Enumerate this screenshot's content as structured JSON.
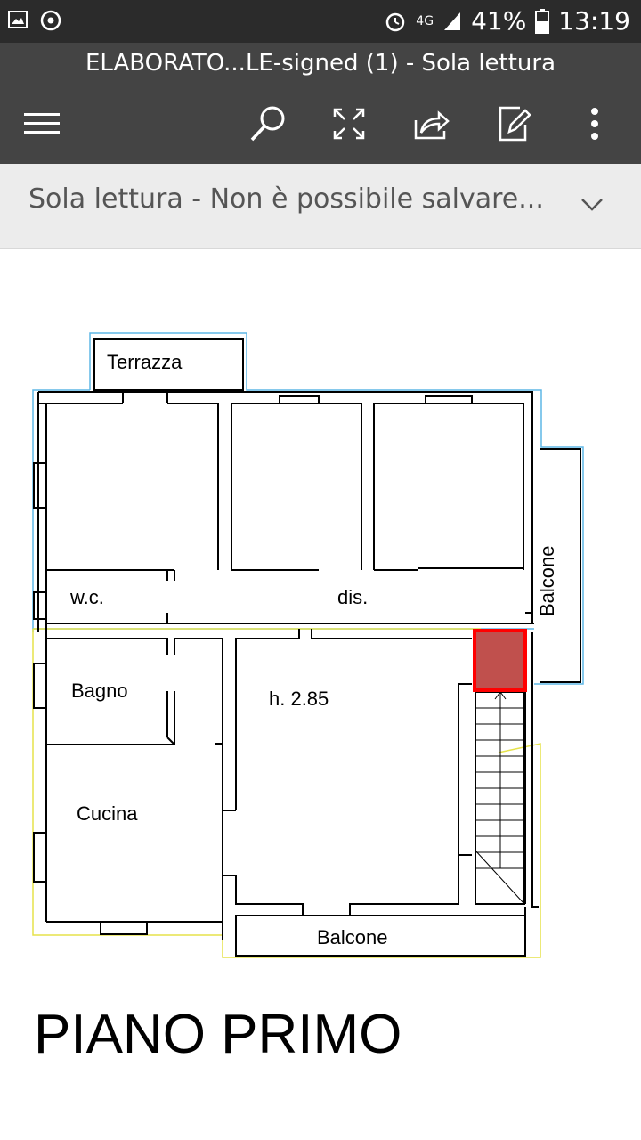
{
  "status_bar": {
    "battery": "41%",
    "time": "13:19",
    "network": "4G"
  },
  "toolbar": {
    "document_title": "ELABORATO...LE-signed (1) - Sola lettura",
    "icons": [
      "menu-icon",
      "search-icon",
      "fullscreen-icon",
      "share-icon",
      "edit-icon",
      "more-icon"
    ]
  },
  "info_bar": {
    "message": "Sola lettura - Non è possibile salvare..."
  },
  "floor_plan": {
    "rooms": {
      "terrazza": "Terrazza",
      "wc": "w.c.",
      "dis": "dis.",
      "balcone_side": "Balcone",
      "bagno": "Bagno",
      "height": "h. 2.85",
      "cucina": "Cucina",
      "balcone_bottom": "Balcone"
    },
    "title": "PIANO PRIMO",
    "highlight_color": "#c0504d"
  }
}
